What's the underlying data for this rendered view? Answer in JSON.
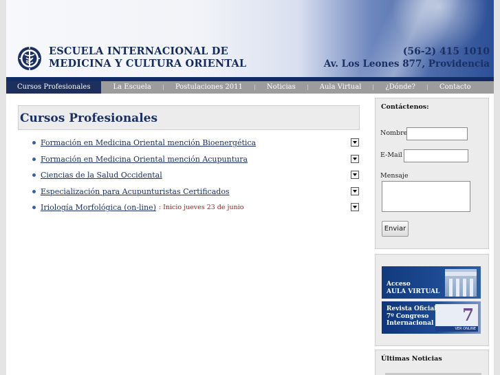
{
  "header": {
    "school_name_line1": "ESCUELA INTERNACIONAL DE",
    "school_name_line2": "MEDICINA Y CULTURA ORIENTAL",
    "phone": "(56-2) 415 1010",
    "address": "Av. Los Leones 877, Providencia",
    "logo_icon": "caduceus-medallion-icon"
  },
  "nav": {
    "items": [
      {
        "label": "Cursos Profesionales",
        "active": true
      },
      {
        "label": "La Escuela"
      },
      {
        "label": "Postulaciones 2011"
      },
      {
        "label": "Noticias"
      },
      {
        "label": "Aula Virtual"
      },
      {
        "label": "¿Dónde?"
      },
      {
        "label": "Contacto"
      }
    ]
  },
  "main": {
    "title": "Cursos Profesionales",
    "courses": [
      {
        "label": "Formación en Medicina Oriental mención Bioenergética",
        "note": ""
      },
      {
        "label": "Formación en Medicina Oriental mención Acupuntura",
        "note": ""
      },
      {
        "label": "Ciencias de la Salud Occidental",
        "note": ""
      },
      {
        "label": "Especialización para Acupunturistas Certificados",
        "note": ""
      },
      {
        "label": "Iriología Morfológica (on-line)",
        "note": ": Inicio jueves 23 de junio"
      }
    ]
  },
  "contact_form": {
    "title": "Contáctenos:",
    "name_label": "Nombre",
    "email_label": "E-Mail",
    "message_label": "Mensaje",
    "name_value": "",
    "email_value": "",
    "message_value": "",
    "submit_label": "Enviar"
  },
  "banners": {
    "aula_line1": "Acceso",
    "aula_line2": "AULA VIRTUAL",
    "revista_line1": "Revista Oficial",
    "revista_line2": "7º Congreso",
    "revista_line3": "Internacional",
    "revista_number": "7",
    "revista_strip": "VER ONLINE"
  },
  "news": {
    "title": "Últimas Noticias"
  },
  "colors": {
    "nav_bg": "#9c9c9c",
    "nav_active": "#1d2f5d",
    "title_blue": "#1c2f62",
    "note_red": "#a0201a"
  }
}
